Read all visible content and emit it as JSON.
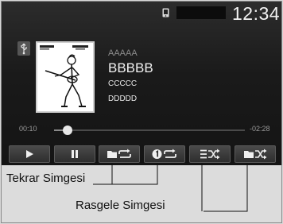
{
  "status_bar": {
    "clock": "12:34",
    "phone_icon": "phone-status-icon"
  },
  "source": {
    "icon": "usb-icon"
  },
  "track": {
    "artist": "AAAAA",
    "title": "BBBBB",
    "album": "CCCCC",
    "extra": "DDDDD"
  },
  "playback": {
    "elapsed": "00:10",
    "remaining": "-02:28",
    "progress_fraction": 0.07
  },
  "controls": [
    {
      "name": "play-button",
      "icon": "play-icon"
    },
    {
      "name": "pause-button",
      "icon": "pause-icon"
    },
    {
      "name": "repeat-folder-button",
      "icon": "repeat-folder-icon"
    },
    {
      "name": "repeat-one-button",
      "icon": "repeat-one-icon"
    },
    {
      "name": "shuffle-button",
      "icon": "shuffle-icon"
    },
    {
      "name": "shuffle-folder-button",
      "icon": "shuffle-folder-icon"
    }
  ],
  "callouts": {
    "repeat_label": "Tekrar Simgesi",
    "random_label": "Rasgele Simgesi"
  },
  "colors": {
    "screen_bg": "#1a1a1a",
    "text_primary": "#f0f0f0",
    "text_muted": "#8c8c8c",
    "caption_bg": "#dcdcdc"
  }
}
